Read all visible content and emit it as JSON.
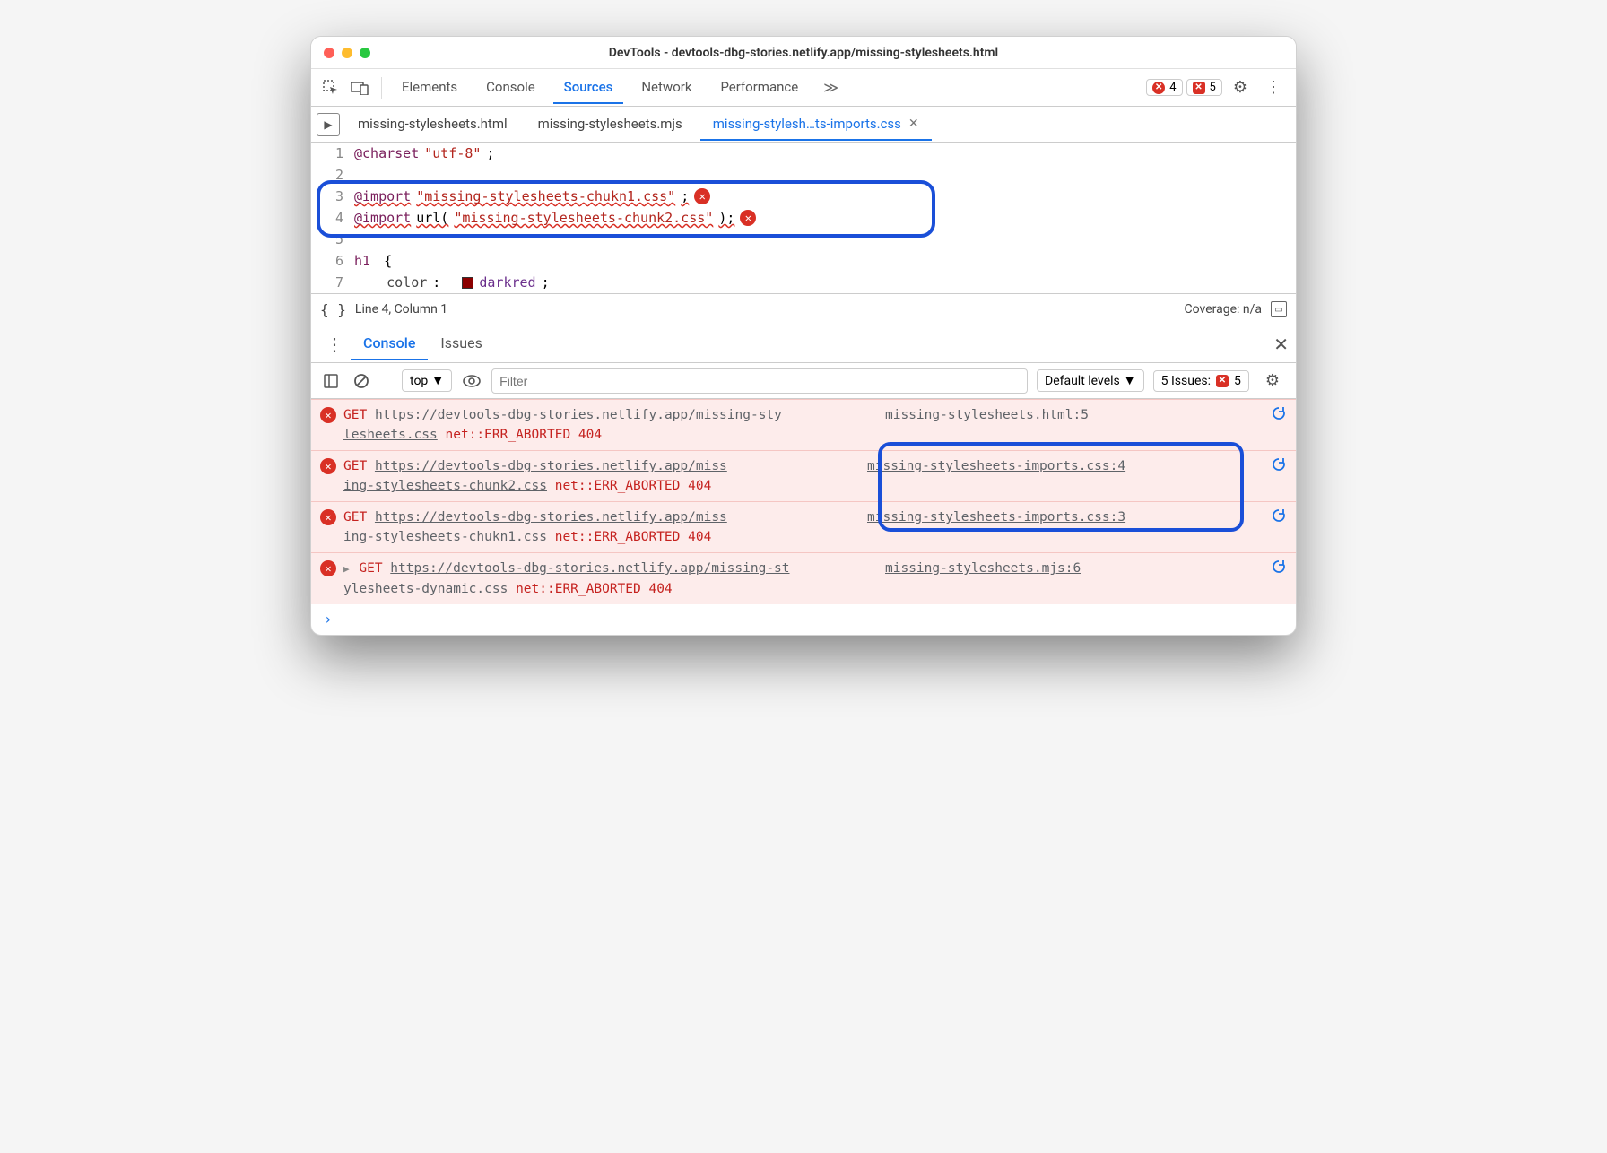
{
  "window": {
    "title": "DevTools - devtools-dbg-stories.netlify.app/missing-stylesheets.html"
  },
  "toolbar": {
    "tabs": [
      "Elements",
      "Console",
      "Sources",
      "Network",
      "Performance"
    ],
    "active_tab": "Sources",
    "error_count": "4",
    "issue_count": "5"
  },
  "file_tabs": {
    "items": [
      {
        "label": "missing-stylesheets.html",
        "active": false,
        "closeable": false
      },
      {
        "label": "missing-stylesheets.mjs",
        "active": false,
        "closeable": false
      },
      {
        "label": "missing-stylesh…ts-imports.css",
        "active": true,
        "closeable": true
      }
    ]
  },
  "editor": {
    "lines": {
      "l1_kw": "@charset",
      "l1_str": "\"utf-8\"",
      "l1_end": ";",
      "l3_kw": "@import",
      "l3_str": "\"missing-stylesheets-chukn1.css\"",
      "l3_end": ";",
      "l4_kw": "@import",
      "l4_fn": "url(",
      "l4_str": "\"missing-stylesheets-chunk2.css\"",
      "l4_end": ");",
      "l6_sel": "h1",
      "l6_brace": " {",
      "l7_prop": "    color",
      "l7_colon": ":  ",
      "l7_val": "darkred",
      "l7_end": ";"
    },
    "line_numbers": [
      "1",
      "2",
      "3",
      "4",
      "5",
      "6",
      "7"
    ]
  },
  "status": {
    "position": "Line 4, Column 1",
    "coverage": "Coverage: n/a"
  },
  "drawer": {
    "tabs": [
      "Console",
      "Issues"
    ],
    "active": "Console"
  },
  "console_toolbar": {
    "context": "top",
    "filter_placeholder": "Filter",
    "levels": "Default levels",
    "issues_label": "5 Issues:",
    "issues_count": "5"
  },
  "console_messages": [
    {
      "method": "GET",
      "url_a": "https://devtools-dbg-stories.netlify.app/missing-sty",
      "url_b": "lesheets.css",
      "err": "net::ERR_ABORTED 404",
      "src": "missing-stylesheets.html:5",
      "expandable": false
    },
    {
      "method": "GET",
      "url_a": "https://devtools-dbg-stories.netlify.app/miss",
      "url_b": "ing-stylesheets-chunk2.css",
      "err": "net::ERR_ABORTED 404",
      "src": "missing-stylesheets-imports.css:4",
      "expandable": false
    },
    {
      "method": "GET",
      "url_a": "https://devtools-dbg-stories.netlify.app/miss",
      "url_b": "ing-stylesheets-chukn1.css",
      "err": "net::ERR_ABORTED 404",
      "src": "missing-stylesheets-imports.css:3",
      "expandable": false
    },
    {
      "method": "GET",
      "url_a": "https://devtools-dbg-stories.netlify.app/missing-st",
      "url_b": "ylesheets-dynamic.css",
      "err": "net::ERR_ABORTED 404",
      "src": "missing-stylesheets.mjs:6",
      "expandable": true
    }
  ]
}
